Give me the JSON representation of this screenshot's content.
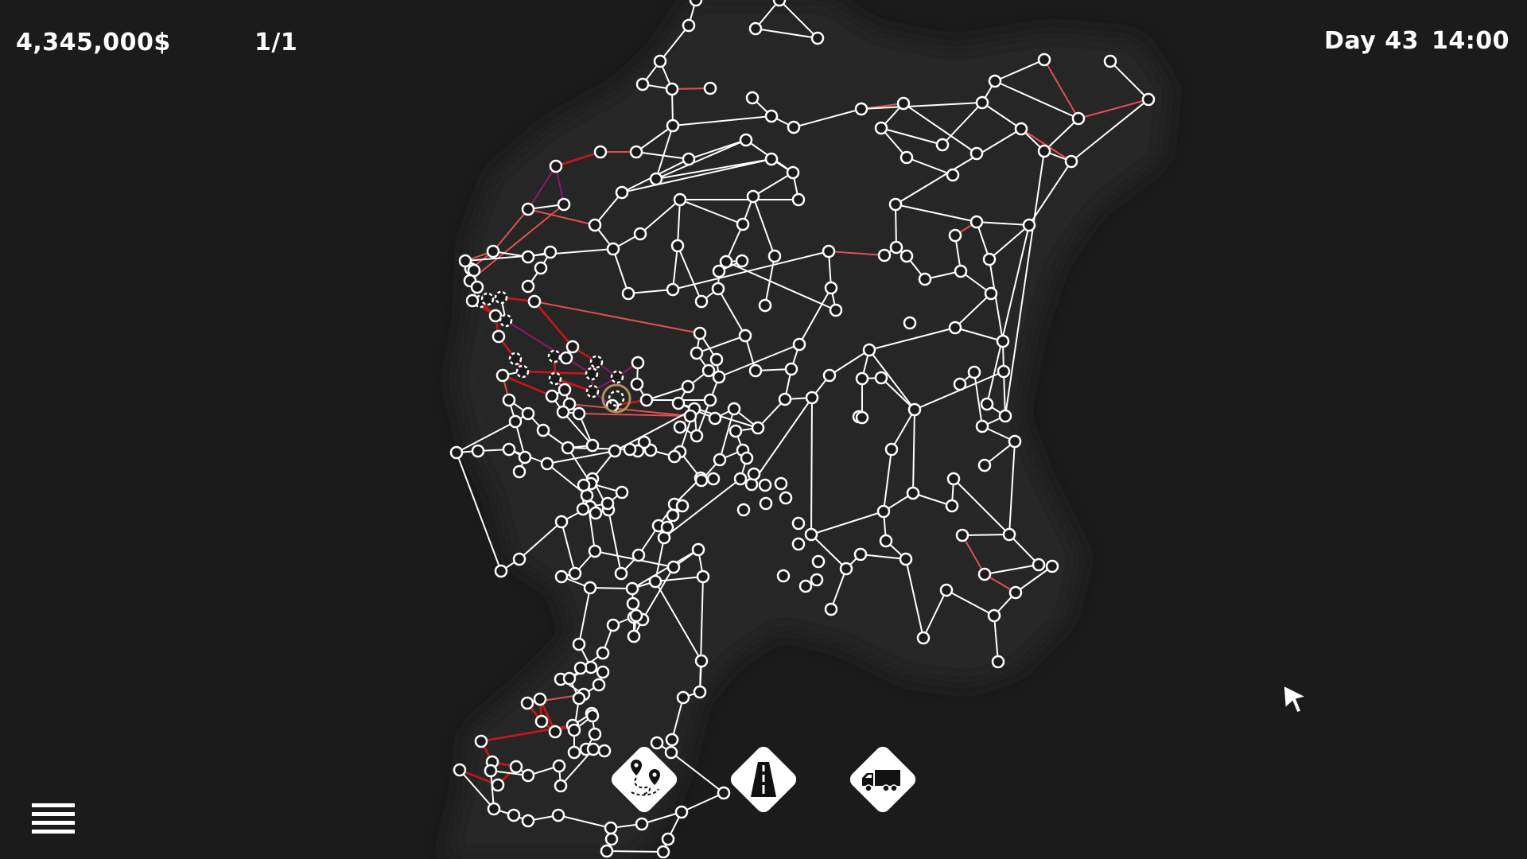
{
  "hud": {
    "money": "4,345,000$",
    "capacity": "1/1",
    "day": "Day 43",
    "time": "14:00"
  },
  "colors": {
    "background": "#1b1b1b",
    "land": "#232323",
    "road": "#ffffff",
    "congested_road": "#e05050",
    "heavy_road": "#c01818",
    "selected_route": "#8a1a6a",
    "depot_ring": "#b09060"
  },
  "toolbar": {
    "items": [
      {
        "name": "route-planner",
        "icon": "map-pins-route-icon"
      },
      {
        "name": "build-road",
        "icon": "road-icon"
      },
      {
        "name": "trucks",
        "icon": "truck-icon"
      }
    ]
  },
  "menu": {
    "icon": "hamburger-menu-icon"
  }
}
